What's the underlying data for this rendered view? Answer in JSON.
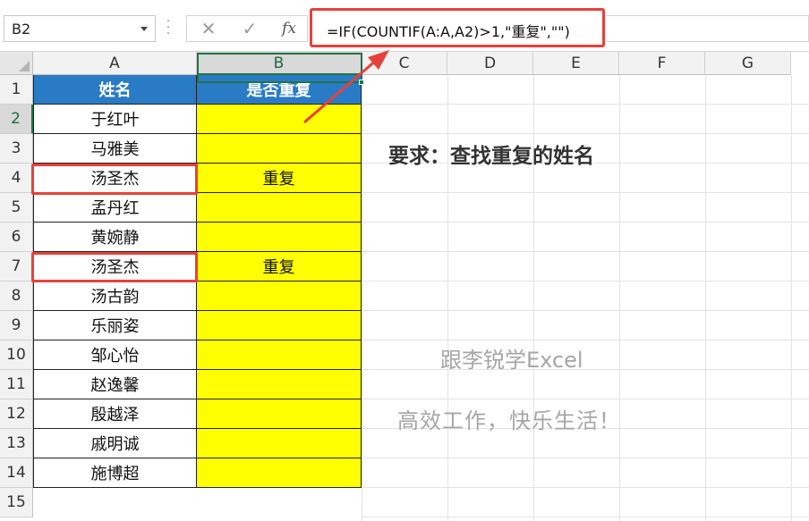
{
  "name_box": "B2",
  "formula_bar": {
    "cancel_icon": "close-icon",
    "enter_icon": "check-icon",
    "fx_label": "fx",
    "formula": "=IF(COUNTIF(A:A,A2)>1,\"重复\",\"\")"
  },
  "columns": [
    "A",
    "B",
    "C",
    "D",
    "E",
    "F",
    "G"
  ],
  "rows": [
    "1",
    "2",
    "3",
    "4",
    "5",
    "6",
    "7",
    "8",
    "9",
    "10",
    "11",
    "12",
    "13",
    "14",
    "15"
  ],
  "table": {
    "headers": [
      "姓名",
      "是否重复"
    ],
    "names": [
      "于红叶",
      "马雅美",
      "汤圣杰",
      "孟丹红",
      "黄婉静",
      "汤圣杰",
      "汤古韵",
      "乐丽姿",
      "邹心怡",
      "赵逸馨",
      "殷越泽",
      "戚明诚",
      "施博超"
    ],
    "dup": [
      "",
      "",
      "重复",
      "",
      "",
      "重复",
      "",
      "",
      "",
      "",
      "",
      "",
      ""
    ]
  },
  "requirement": "要求：查找重复的姓名",
  "watermark": [
    "跟李锐学Excel",
    "高效工作，快乐生活！"
  ],
  "colors": {
    "header_blue": "#2a7bc6",
    "highlight_yellow": "#ffff00",
    "annotation_red": "#e8403a",
    "excel_green": "#217346"
  }
}
